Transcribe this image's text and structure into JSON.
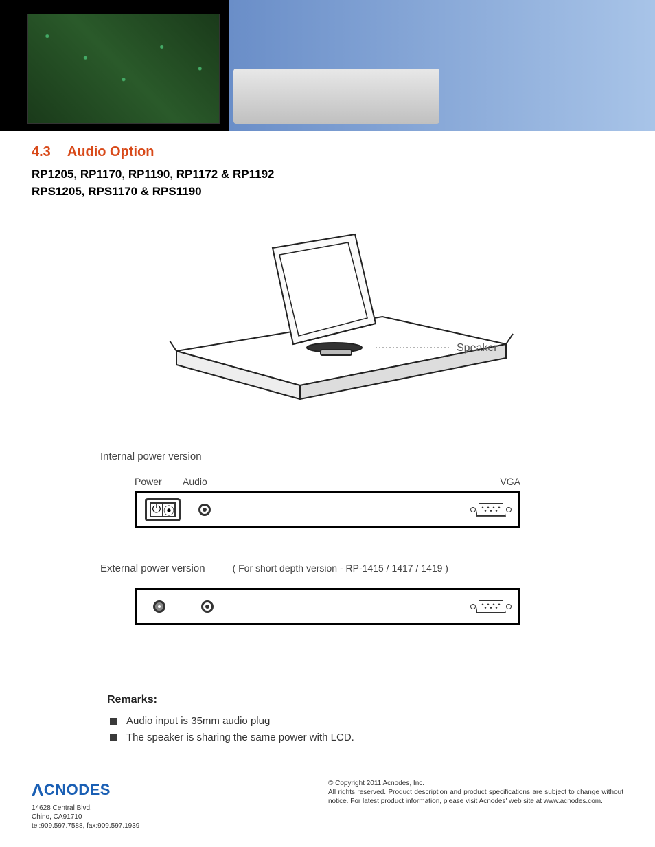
{
  "section": {
    "number": "4.3",
    "title": "Audio  Option"
  },
  "models": {
    "line1": "RP1205, RP1170, RP1190, RP1172 & RP1192",
    "line2": "RPS1205, RPS1170 & RPS1190"
  },
  "figure": {
    "speaker_label": "Speaker"
  },
  "panels": {
    "internal": {
      "title": "Internal power version",
      "labels": {
        "power": "Power",
        "audio": "Audio",
        "vga": "VGA"
      }
    },
    "external": {
      "title": "External power version",
      "note": "( For short depth version - RP-1415 / 1417 / 1419 )"
    }
  },
  "remarks": {
    "heading": "Remarks:",
    "items": [
      "Audio input is 35mm audio plug",
      "The speaker is sharing the same power with LCD."
    ]
  },
  "footer": {
    "logo": "CNODES",
    "address1": "14628 Central Blvd,",
    "address2": "Chino, CA91710",
    "phone": "tel:909.597.7588, fax:909.597.1939",
    "copyright": "© Copyright 2011 Acnodes, Inc.",
    "legal": "All rights reserved. Product description and product specifications are subject to change without notice. For latest product information, please visit Acnodes' web site at www.acnodes.com."
  }
}
